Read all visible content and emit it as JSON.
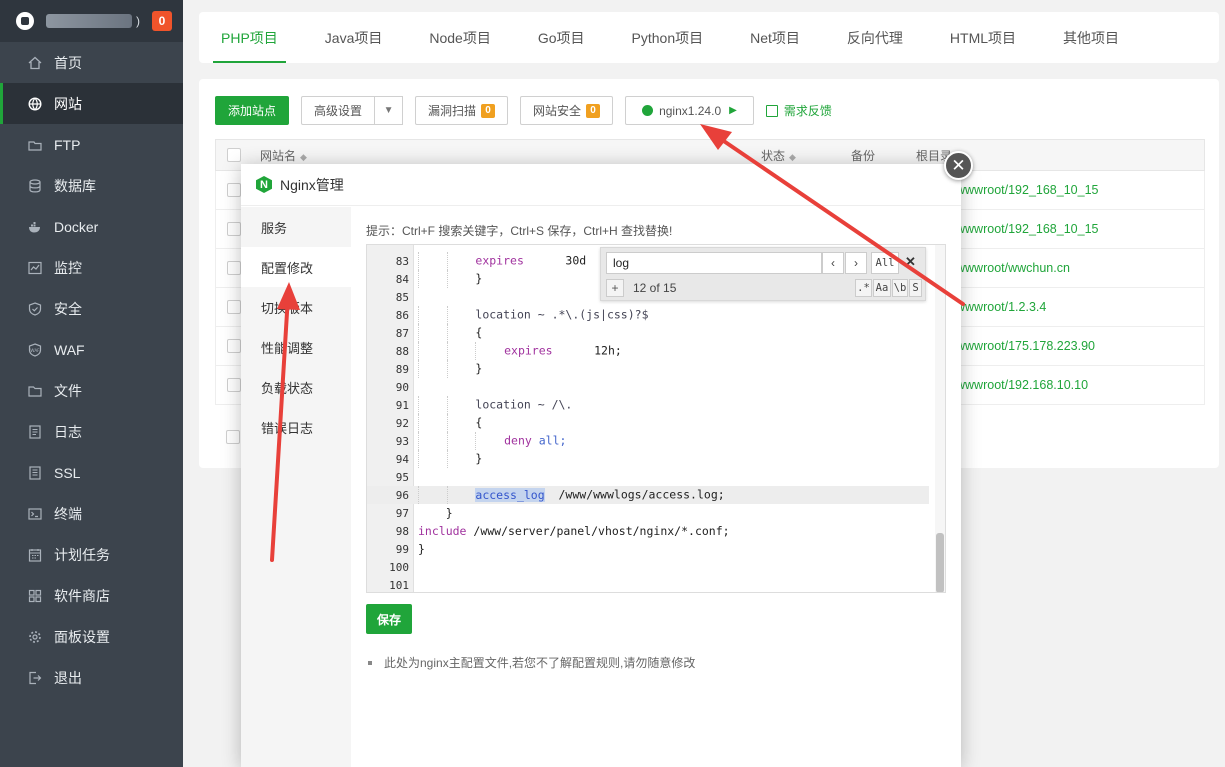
{
  "sidebar": {
    "host_suffix": ")",
    "badge": "0",
    "items": [
      {
        "label": "首页",
        "icon": "home-icon"
      },
      {
        "label": "网站",
        "icon": "globe-icon"
      },
      {
        "label": "FTP",
        "icon": "ftp-icon"
      },
      {
        "label": "数据库",
        "icon": "database-icon"
      },
      {
        "label": "Docker",
        "icon": "docker-icon"
      },
      {
        "label": "监控",
        "icon": "monitor-icon"
      },
      {
        "label": "安全",
        "icon": "shield-icon"
      },
      {
        "label": "WAF",
        "icon": "waf-icon"
      },
      {
        "label": "文件",
        "icon": "folder-icon"
      },
      {
        "label": "日志",
        "icon": "log-icon"
      },
      {
        "label": "SSL",
        "icon": "ssl-icon"
      },
      {
        "label": "终端",
        "icon": "terminal-icon"
      },
      {
        "label": "计划任务",
        "icon": "calendar-icon"
      },
      {
        "label": "软件商店",
        "icon": "apps-icon"
      },
      {
        "label": "面板设置",
        "icon": "gear-icon"
      },
      {
        "label": "退出",
        "icon": "logout-icon"
      }
    ],
    "active_index": 1
  },
  "tabs": [
    "PHP项目",
    "Java项目",
    "Node项目",
    "Go项目",
    "Python项目",
    "Net项目",
    "反向代理",
    "HTML项目",
    "其他项目"
  ],
  "toolbar": {
    "add_site": "添加站点",
    "advanced": "高级设置",
    "vuln_scan": "漏洞扫描",
    "vuln_count": "0",
    "site_security": "网站安全",
    "security_count": "0",
    "nginx_version": "nginx1.24.0",
    "feedback": "需求反馈"
  },
  "table": {
    "headers": {
      "name": "网站名",
      "status": "状态",
      "backup": "备份",
      "root": "根目录"
    },
    "rows": [
      {
        "root": "wwwroot/192_168_10_15"
      },
      {
        "root": "wwwroot/192_168_10_15"
      },
      {
        "root": "wwwroot/wwchun.cn"
      },
      {
        "root": "wwwroot/1.2.3.4"
      },
      {
        "root": "wwwroot/175.178.223.90"
      },
      {
        "root": "wwwroot/192.168.10.10"
      }
    ]
  },
  "modal": {
    "title": "Nginx管理",
    "side_items": [
      "服务",
      "配置修改",
      "切换版本",
      "性能调整",
      "负载状态",
      "错误日志"
    ],
    "active_side": 1,
    "hint": "提示：Ctrl+F 搜索关键字，Ctrl+S 保存，Ctrl+H 查找替换!",
    "save": "保存",
    "note": "此处为nginx主配置文件,若您不了解配置规则,请勿随意修改"
  },
  "search": {
    "query": "log",
    "all": "All",
    "count": "12 of 15",
    "opt_regex": ".*",
    "opt_case": "Aa",
    "opt_word": "\\b",
    "opt_sel": "S"
  },
  "editor_lines": [
    "83",
    "84",
    "85",
    "86",
    "87",
    "88",
    "89",
    "90",
    "91",
    "92",
    "93",
    "94",
    "95",
    "96",
    "97",
    "98",
    "99",
    "100",
    "101"
  ],
  "code": {
    "expires": "expires",
    "v30": "30d",
    "v12": "12h;",
    "loc1": "location ~ .*\\.(js|css)?$",
    "loc2": "location ~ /\\.",
    "deny": "deny",
    "all": "all;",
    "access_log": "access_log",
    "access_path": "  /www/wwwlogs/access.log;",
    "include": "include",
    "include_path": " /www/server/panel/vhost/nginx/*.conf;",
    "brace_open": "{",
    "brace_close": "}"
  },
  "colors": {
    "accent": "#20a53a",
    "sidebar": "#3c444d",
    "badge": "#f0542b",
    "arrow": "#e8403a"
  }
}
